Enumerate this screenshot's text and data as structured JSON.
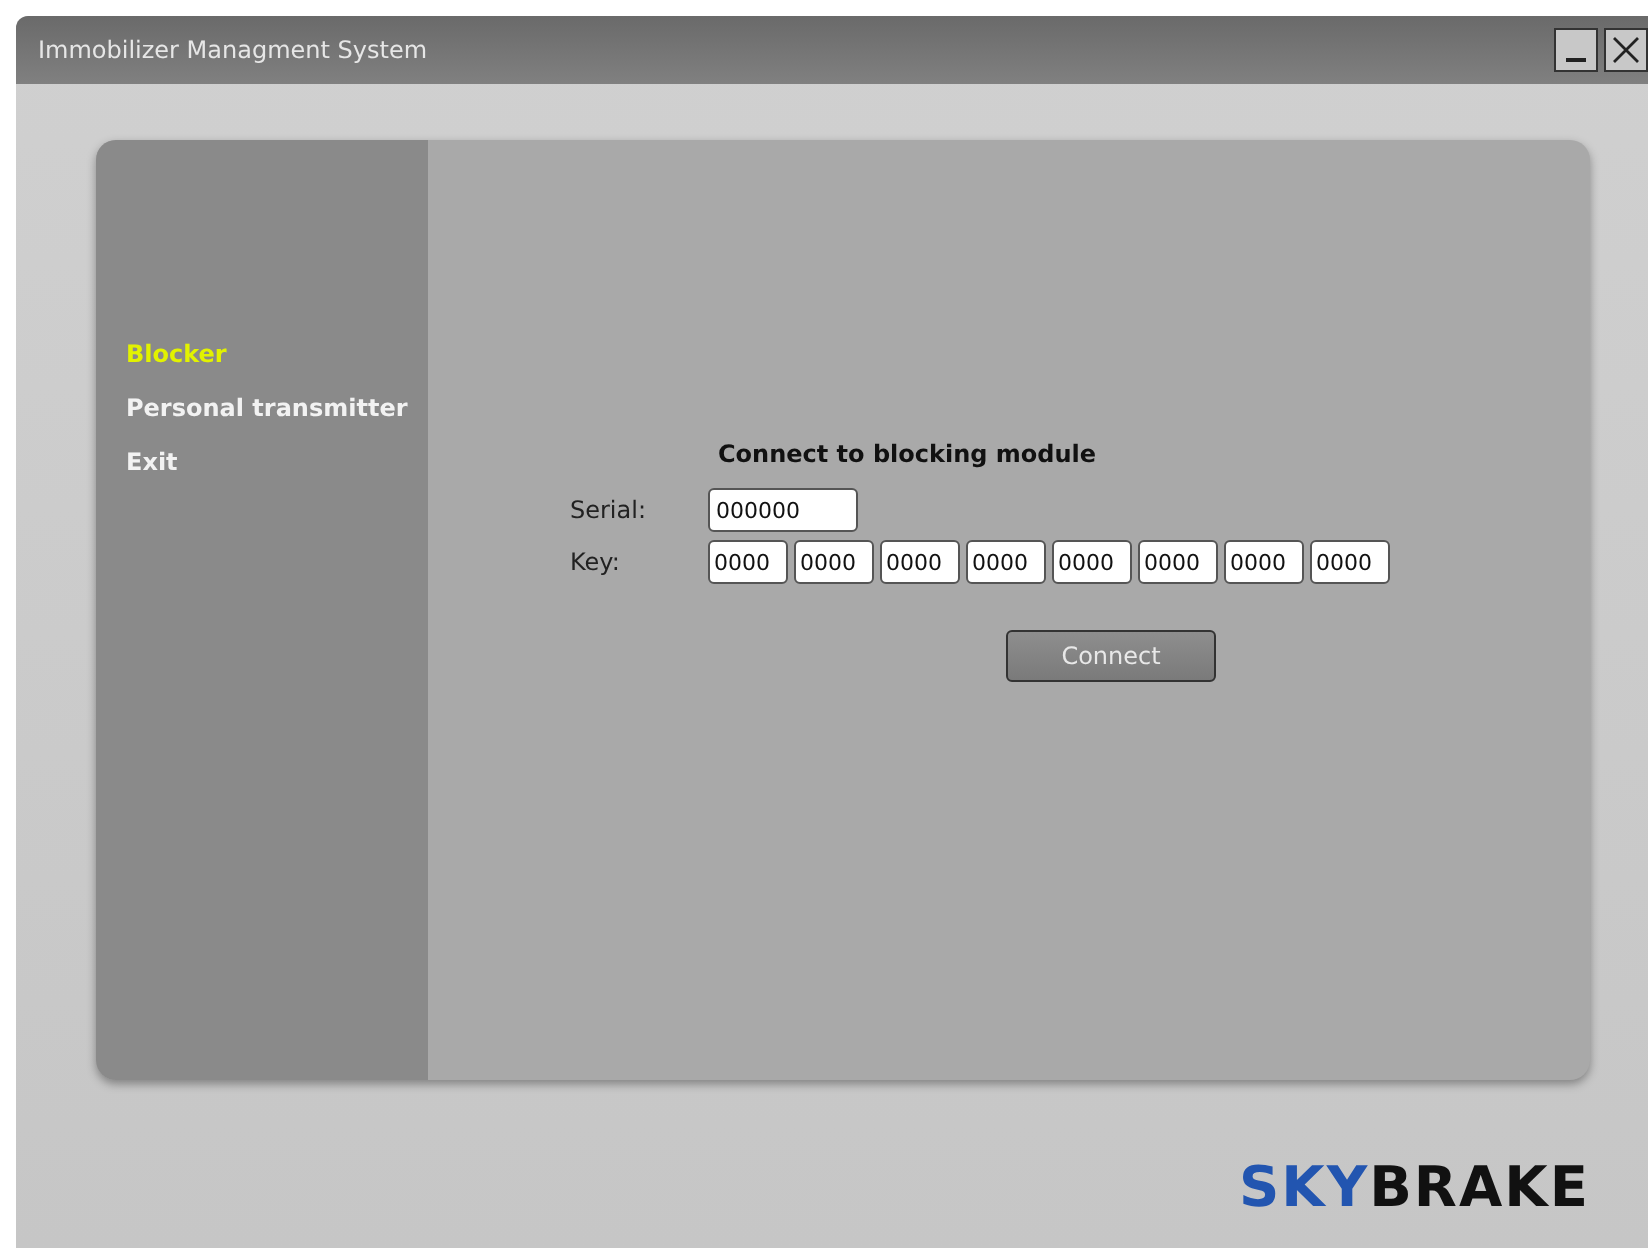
{
  "window": {
    "title": "Immobilizer Managment System"
  },
  "sidebar": {
    "items": [
      {
        "label": "Blocker",
        "selected": true
      },
      {
        "label": "Personal transmitter",
        "selected": false
      },
      {
        "label": "Exit",
        "selected": false
      }
    ]
  },
  "form": {
    "title": "Connect to blocking module",
    "serial_label": "Serial:",
    "serial_value": "000000",
    "key_label": "Key:",
    "key_values": [
      "0000",
      "0000",
      "0000",
      "0000",
      "0000",
      "0000",
      "0000",
      "0000"
    ],
    "connect_button": "Connect"
  },
  "logo": {
    "part_1": "SKY",
    "part_2": "BRAKE"
  }
}
